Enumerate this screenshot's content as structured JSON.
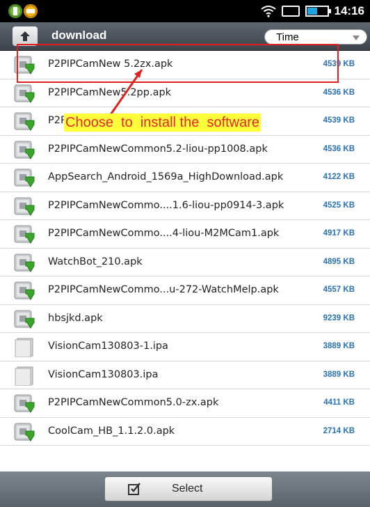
{
  "status_bar": {
    "time": "14:16",
    "left_icons": [
      "add-contact-green-icon",
      "add-yellow-icon"
    ],
    "right_icons": [
      "wifi-icon",
      "data-transfer-icon",
      "battery-icon"
    ]
  },
  "header": {
    "path": "download",
    "sort_label": "Time"
  },
  "files": [
    {
      "name": "P2PIPCamNew 5.2zx.apk",
      "size": "4539 KB",
      "icon": "apk-package-icon"
    },
    {
      "name": "P2PIPCamNew5.2pp.apk",
      "size": "4536 KB",
      "icon": "apk-package-icon"
    },
    {
      "name": "P2P",
      "size": "4539 KB",
      "icon": "apk-package-icon"
    },
    {
      "name": "P2PIPCamNewCommon5.2-liou-pp1008.apk",
      "size": "4536 KB",
      "icon": "apk-package-icon"
    },
    {
      "name": "AppSearch_Android_1569a_HighDownload.apk",
      "size": "4122 KB",
      "icon": "apk-package-icon"
    },
    {
      "name": "P2PIPCamNewCommo....1.6-liou-pp0914-3.apk",
      "size": "4525 KB",
      "icon": "apk-package-icon"
    },
    {
      "name": "P2PIPCamNewCommo....4-liou-M2MCam1.apk",
      "size": "4917 KB",
      "icon": "apk-package-icon"
    },
    {
      "name": "WatchBot_210.apk",
      "size": "4895 KB",
      "icon": "apk-package-icon"
    },
    {
      "name": "P2PIPCamNewCommo...u-272-WatchMelp.apk",
      "size": "4557 KB",
      "icon": "apk-package-icon"
    },
    {
      "name": "hbsjkd.apk",
      "size": "9239 KB",
      "icon": "apk-package-icon"
    },
    {
      "name": "VisionCam130803-1.ipa",
      "size": "3889 KB",
      "icon": "generic-file-icon"
    },
    {
      "name": "VisionCam130803.ipa",
      "size": "3889 KB",
      "icon": "generic-file-icon"
    },
    {
      "name": "P2PIPCamNewCommon5.0-zx.apk",
      "size": "4411 KB",
      "icon": "apk-package-icon"
    },
    {
      "name": "CoolCam_HB_1.1.2.0.apk",
      "size": "2714 KB",
      "icon": "apk-package-icon"
    }
  ],
  "annotation": {
    "text": "Choose  to  install the  software"
  },
  "bottom": {
    "select_label": "Select"
  },
  "colors": {
    "size_text": "#2a72b8",
    "annotation_red": "#e0201c",
    "annotation_bg": "#ffff3a"
  }
}
